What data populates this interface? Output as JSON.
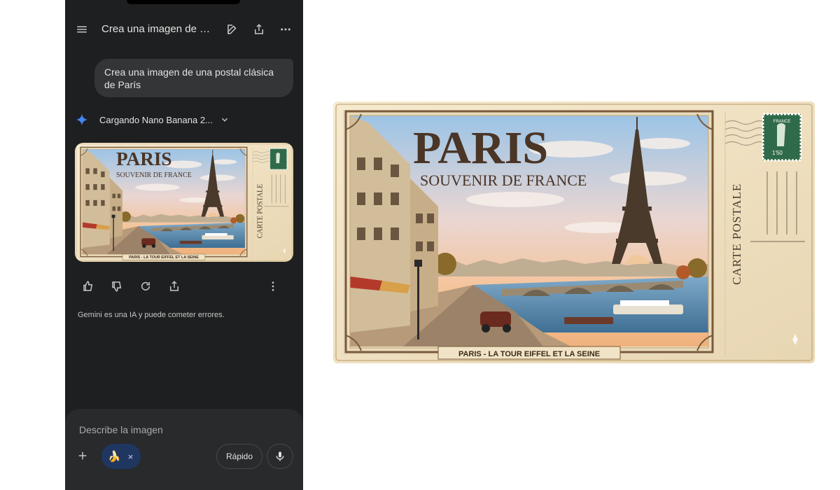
{
  "header": {
    "title": "Crea una imagen de u..."
  },
  "conversation": {
    "user_message": "Crea una imagen de una postal clásica de París",
    "model_status": "Cargando Nano Banana 2...",
    "disclaimer": "Gemini es una IA y puede cometer errores."
  },
  "postcard": {
    "title": "PARIS",
    "subtitle": "SOUVENIR DE FRANCE",
    "side_label": "CARTE POSTALE",
    "caption": "PARIS - LA TOUR EIFFEL ET LA SEINE",
    "stamp_country": "FRANCE",
    "stamp_value": "1'50"
  },
  "composer": {
    "placeholder": "Describe la imagen",
    "chip_icon": "🍌",
    "chip_close": "×",
    "speed_label": "Rápido"
  },
  "icons": {
    "menu": "menu-icon",
    "edit": "edit-icon",
    "share": "share-icon",
    "more": "more-icon",
    "spark": "gemini-spark-icon",
    "thumb_up": "thumbs-up-icon",
    "thumb_down": "thumbs-down-icon",
    "regenerate": "regenerate-icon",
    "export": "export-icon",
    "plus": "plus-icon",
    "mic": "mic-icon"
  },
  "colors": {
    "phone_bg": "#1e1f20",
    "bubble_bg": "#333537",
    "composer_bg": "#282a2c",
    "chip_bg": "#1f3760",
    "accent_blue": "#4285f4"
  }
}
